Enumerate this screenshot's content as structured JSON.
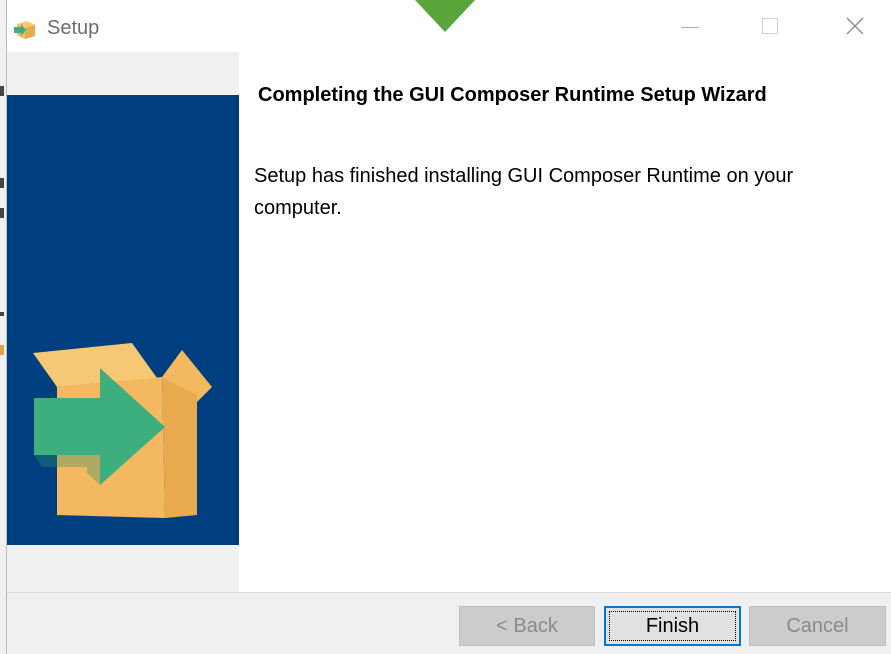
{
  "window": {
    "title": "Setup",
    "minimize_icon": "minimize-icon",
    "maximize_icon": "maximize-icon",
    "close_icon": "close-icon"
  },
  "wizard": {
    "heading": "Completing the GUI Composer Runtime Setup Wizard",
    "message": "Setup has finished installing GUI Composer Runtime on your computer."
  },
  "buttons": {
    "back": "< Back",
    "finish": "Finish",
    "cancel": "Cancel"
  },
  "colors": {
    "banner": "#003f7f",
    "box": "#f4b860",
    "box_shade": "#e8a94f",
    "arrow": "#3daf7e",
    "top_arrow": "#5aa53a"
  }
}
